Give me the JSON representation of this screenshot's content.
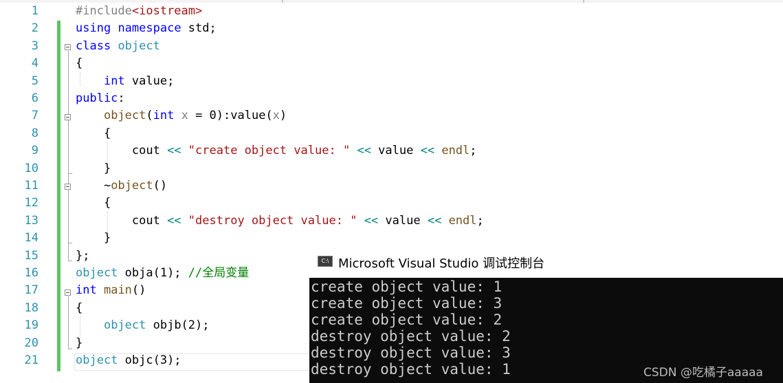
{
  "editor": {
    "line_numbers": [
      "1",
      "2",
      "3",
      "4",
      "5",
      "6",
      "7",
      "8",
      "9",
      "10",
      "11",
      "12",
      "13",
      "14",
      "15",
      "16",
      "17",
      "18",
      "19",
      "20",
      "21"
    ],
    "lines": [
      [
        {
          "t": "#include",
          "c": "pp"
        },
        {
          "t": "<iostream>",
          "c": "str"
        }
      ],
      [
        {
          "t": "using",
          "c": "kw"
        },
        {
          "t": " "
        },
        {
          "t": "namespace",
          "c": "kw"
        },
        {
          "t": " std;"
        }
      ],
      [
        {
          "t": "class",
          "c": "kw"
        },
        {
          "t": " "
        },
        {
          "t": "object",
          "c": "ty"
        }
      ],
      [
        {
          "t": "{"
        }
      ],
      [
        {
          "t": "    "
        },
        {
          "t": "int",
          "c": "kw"
        },
        {
          "t": " value;"
        }
      ],
      [
        {
          "t": "public",
          "c": "kw"
        },
        {
          "t": ":"
        }
      ],
      [
        {
          "t": "    "
        },
        {
          "t": "object",
          "c": "fn"
        },
        {
          "t": "("
        },
        {
          "t": "int",
          "c": "kw"
        },
        {
          "t": " "
        },
        {
          "t": "x",
          "c": "par"
        },
        {
          "t": " = 0):value("
        },
        {
          "t": "x",
          "c": "par"
        },
        {
          "t": ")"
        }
      ],
      [
        {
          "t": "    {"
        }
      ],
      [
        {
          "t": "        cout "
        },
        {
          "t": "<<",
          "c": "op"
        },
        {
          "t": " "
        },
        {
          "t": "\"create object value: \"",
          "c": "str"
        },
        {
          "t": " "
        },
        {
          "t": "<<",
          "c": "op"
        },
        {
          "t": " value "
        },
        {
          "t": "<<",
          "c": "op"
        },
        {
          "t": " "
        },
        {
          "t": "endl",
          "c": "fn"
        },
        {
          "t": ";"
        }
      ],
      [
        {
          "t": "    }"
        }
      ],
      [
        {
          "t": "    ~"
        },
        {
          "t": "object",
          "c": "fn"
        },
        {
          "t": "()"
        }
      ],
      [
        {
          "t": "    {"
        }
      ],
      [
        {
          "t": "        cout "
        },
        {
          "t": "<<",
          "c": "op"
        },
        {
          "t": " "
        },
        {
          "t": "\"destroy object value: \"",
          "c": "str"
        },
        {
          "t": " "
        },
        {
          "t": "<<",
          "c": "op"
        },
        {
          "t": " value "
        },
        {
          "t": "<<",
          "c": "op"
        },
        {
          "t": " "
        },
        {
          "t": "endl",
          "c": "fn"
        },
        {
          "t": ";"
        }
      ],
      [
        {
          "t": "    }"
        }
      ],
      [
        {
          "t": "};"
        }
      ],
      [
        {
          "t": "object",
          "c": "ty"
        },
        {
          "t": " obja(1); "
        },
        {
          "t": "//全局变量",
          "c": "cm"
        }
      ],
      [
        {
          "t": "int",
          "c": "kw"
        },
        {
          "t": " "
        },
        {
          "t": "main",
          "c": "fn"
        },
        {
          "t": "()"
        }
      ],
      [
        {
          "t": "{"
        }
      ],
      [
        {
          "t": "    "
        },
        {
          "t": "object",
          "c": "ty"
        },
        {
          "t": " objb(2);"
        }
      ],
      [
        {
          "t": "}"
        }
      ],
      [
        {
          "t": "object",
          "c": "ty"
        },
        {
          "t": " objc(3);"
        }
      ]
    ]
  },
  "console": {
    "icon_label": "C:\\",
    "icon": "console-app-icon",
    "title": "Microsoft Visual Studio 调试控制台",
    "output": [
      "create object value: 1",
      "create object value: 3",
      "create object value: 2",
      "destroy object value: 2",
      "destroy object value: 3",
      "destroy object value: 1"
    ]
  },
  "watermark": "CSDN @吃橘子aaaaa",
  "colors": {
    "keyword": "#0000ff",
    "type": "#2b91af",
    "function": "#74531f",
    "string": "#a31515",
    "comment": "#008000",
    "change_bar": "#5cc561",
    "console_bg": "#0c0c0c"
  }
}
